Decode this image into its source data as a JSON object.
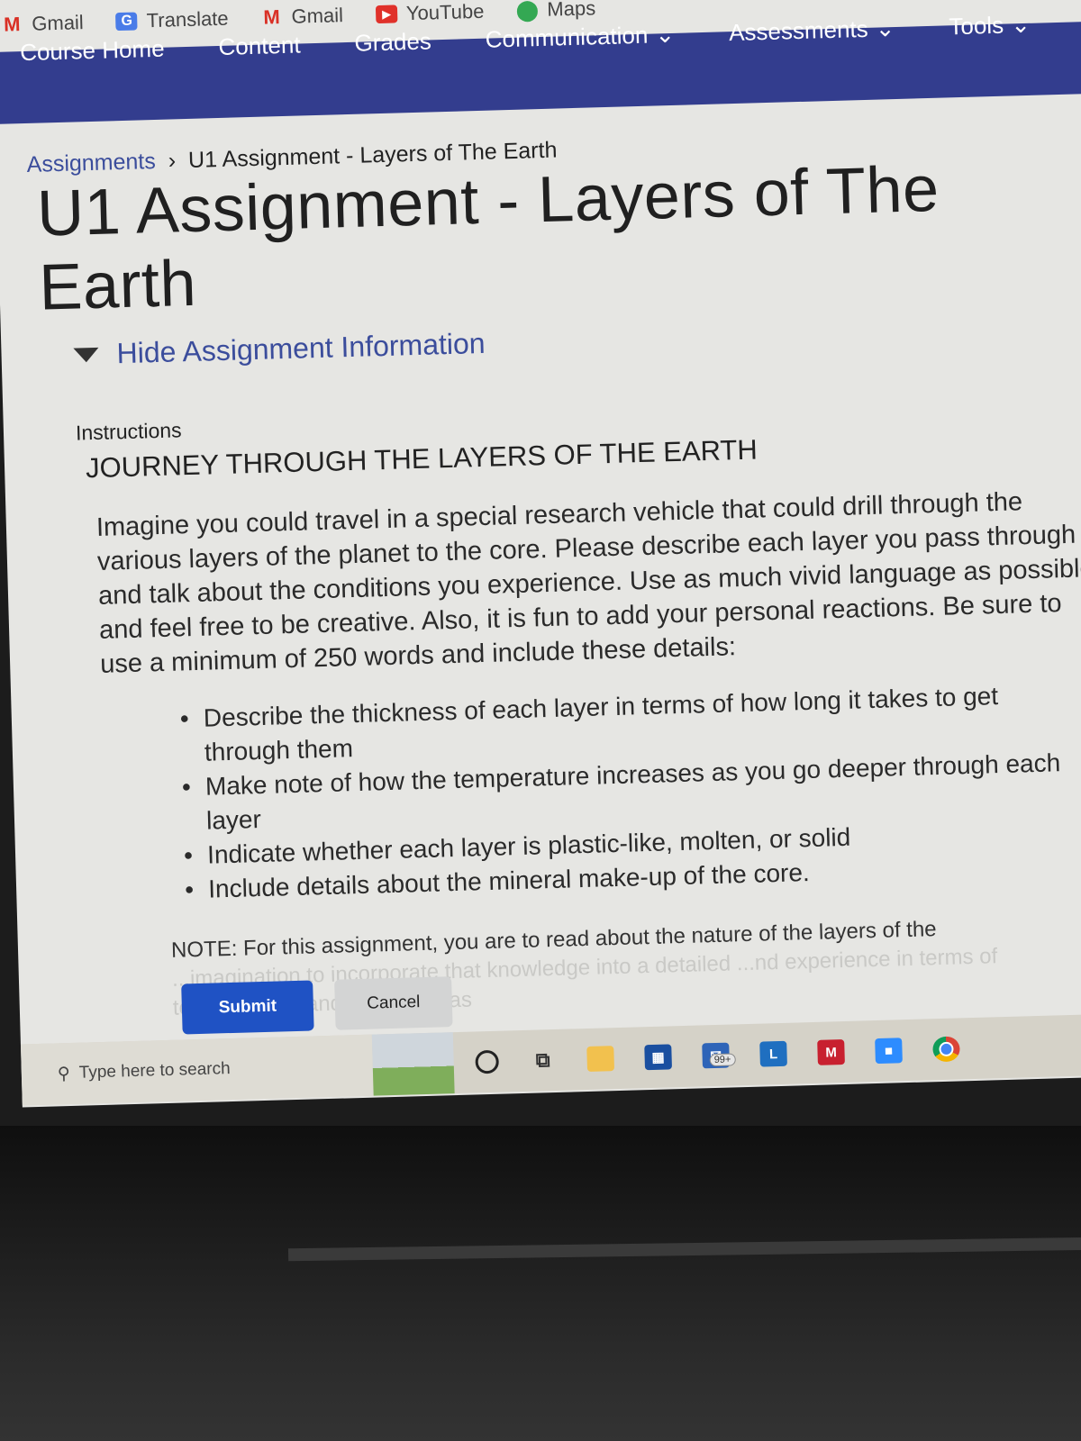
{
  "bookmarks": [
    {
      "label": "Gmail",
      "icon": "gmail-icon"
    },
    {
      "label": "Translate",
      "icon": "translate-icon"
    },
    {
      "label": "Gmail",
      "icon": "gmail-icon"
    },
    {
      "label": "YouTube",
      "icon": "youtube-icon"
    },
    {
      "label": "Maps",
      "icon": "maps-icon"
    }
  ],
  "navbar": {
    "items": [
      {
        "label": "Course Home"
      },
      {
        "label": "Content"
      },
      {
        "label": "Grades"
      },
      {
        "label": "Communication",
        "dropdown": true
      },
      {
        "label": "Assessments",
        "dropdown": true
      },
      {
        "label": "Tools",
        "dropdown": true
      }
    ],
    "color": "#333d8e"
  },
  "breadcrumb": {
    "parent": "Assignments",
    "separator": "›",
    "current": "U1 Assignment - Layers of The Earth"
  },
  "page": {
    "title": "U1 Assignment - Layers of The Earth",
    "toggle_label": "Hide Assignment Information",
    "instructions_label": "Instructions",
    "heading": "JOURNEY THROUGH THE LAYERS OF THE EARTH",
    "paragraph": "Imagine you could travel in a special research vehicle that could drill through the various layers of the planet to the core. Please describe each layer you pass through and talk about the conditions you experience. Use as much vivid language as possible and feel free to be creative. Also, it is fun to add your personal reactions. Be sure to use a minimum of 250 words and include these details:",
    "bullets": [
      "Describe the thickness of each layer in terms of how long it takes to get through them",
      "Make note of how the temperature increases as you go deeper through each layer",
      "Indicate whether each layer is plastic-like, molten, or solid",
      "Include details about the mineral make-up of the core."
    ],
    "note": "NOTE: For this assignment, you are to read about the nature of the layers of the",
    "note_faded": "...imagination to incorporate that knowledge into a detailed ...nd experience in terms of temperatures and pressures as"
  },
  "actions": {
    "submit": "Submit",
    "cancel": "Cancel"
  },
  "taskbar": {
    "search_placeholder": "Type here to search",
    "mail_badge": "99+",
    "l_app_label": "L",
    "apps": [
      "cortana",
      "task-view",
      "file-explorer",
      "microsoft-store",
      "mail",
      "l-app",
      "mcafee",
      "zoom",
      "chrome"
    ]
  }
}
